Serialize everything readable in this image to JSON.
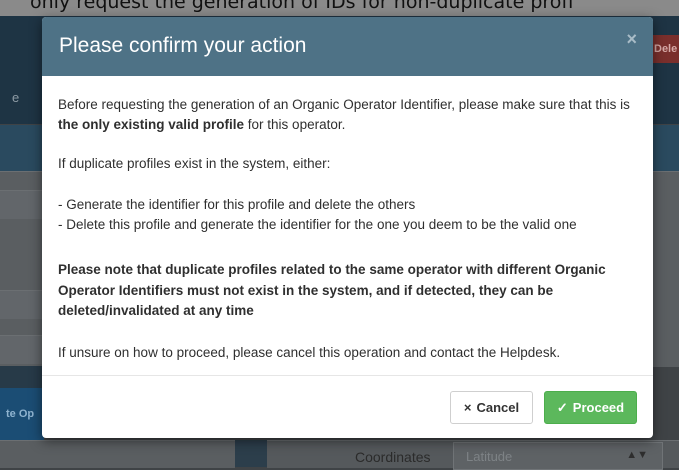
{
  "background": {
    "top_text": "only request the generation of IDs for non-duplicate profi",
    "left_text_1": "e",
    "left_button": "te Op",
    "delete_button": "Dele",
    "coordinates_label": "Coordinates",
    "latitude_placeholder": "Latitude",
    "spinner_icon": "up-down-arrows-icon"
  },
  "modal": {
    "title": "Please confirm your action",
    "close_symbol": "×",
    "intro_before": "Before requesting the generation of an Organic Operator Identifier, please make sure that this is ",
    "intro_bold": "the only existing valid profile",
    "intro_after": " for this operator.",
    "duplicates_intro": "If duplicate profiles exist in the system, either:",
    "option_1": "- Generate the identifier for this profile and delete the others",
    "option_2": "- Delete this profile and generate the identifier for the one you deem to be the valid one",
    "note": "Please note that duplicate profiles related to the same operator with different Organic Operator Identifiers must not exist in the system, and if detected, they can be deleted/invalidated at any time",
    "unsure": "If unsure on how to proceed, please cancel this operation and contact the Helpdesk.",
    "cancel_icon": "×",
    "cancel_label": "Cancel",
    "proceed_icon": "✓",
    "proceed_label": "Proceed"
  },
  "colors": {
    "header": "#4e7286",
    "proceed": "#5cb85c",
    "overlay": "#3f4346"
  }
}
